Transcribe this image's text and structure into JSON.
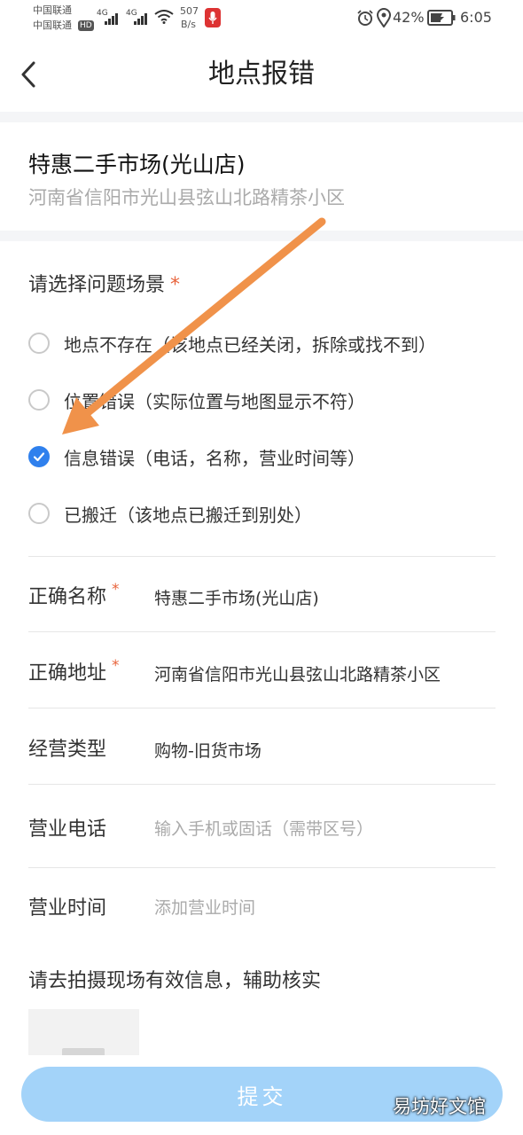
{
  "status_bar": {
    "carrier_1": "中国联通",
    "carrier_2": "中国联通",
    "hd_badge": "HD",
    "network_1": "4G",
    "network_2": "4G",
    "speed_value": "507",
    "speed_unit": "B/s",
    "battery_percent": "42%",
    "time": "6:05"
  },
  "header": {
    "title": "地点报错"
  },
  "poi": {
    "name": "特惠二手市场(光山店)",
    "address": "河南省信阳市光山县弦山北路精茶小区"
  },
  "scene": {
    "title": "请选择问题场景",
    "required_mark": "*",
    "options": [
      {
        "label": "地点不存在（该地点已经关闭，拆除或找不到）",
        "checked": false
      },
      {
        "label": "位置错误（实际位置与地图显示不符）",
        "checked": false
      },
      {
        "label": "信息错误（电话，名称，营业时间等）",
        "checked": true
      },
      {
        "label": "已搬迁（该地点已搬迁到别处）",
        "checked": false
      }
    ]
  },
  "fields": {
    "name_label": "正确名称",
    "name_required": "*",
    "name_value": "特惠二手市场(光山店)",
    "address_label": "正确地址",
    "address_required": "*",
    "address_value": "河南省信阳市光山县弦山北路精茶小区",
    "type_label": "经营类型",
    "type_value": "购物-旧货市场",
    "phone_label": "营业电话",
    "phone_placeholder": "输入手机或固话（需带区号）",
    "hours_label": "营业时间",
    "hours_placeholder": "添加营业时间"
  },
  "photo": {
    "title": "请去拍摄现场有效信息，辅助核实"
  },
  "submit_label": "提交",
  "watermark": "易坊好文馆",
  "colors": {
    "accent": "#2f80ed",
    "submit_bg": "#a3d3f9",
    "required": "#e8643c",
    "arrow": "#f0924a"
  }
}
